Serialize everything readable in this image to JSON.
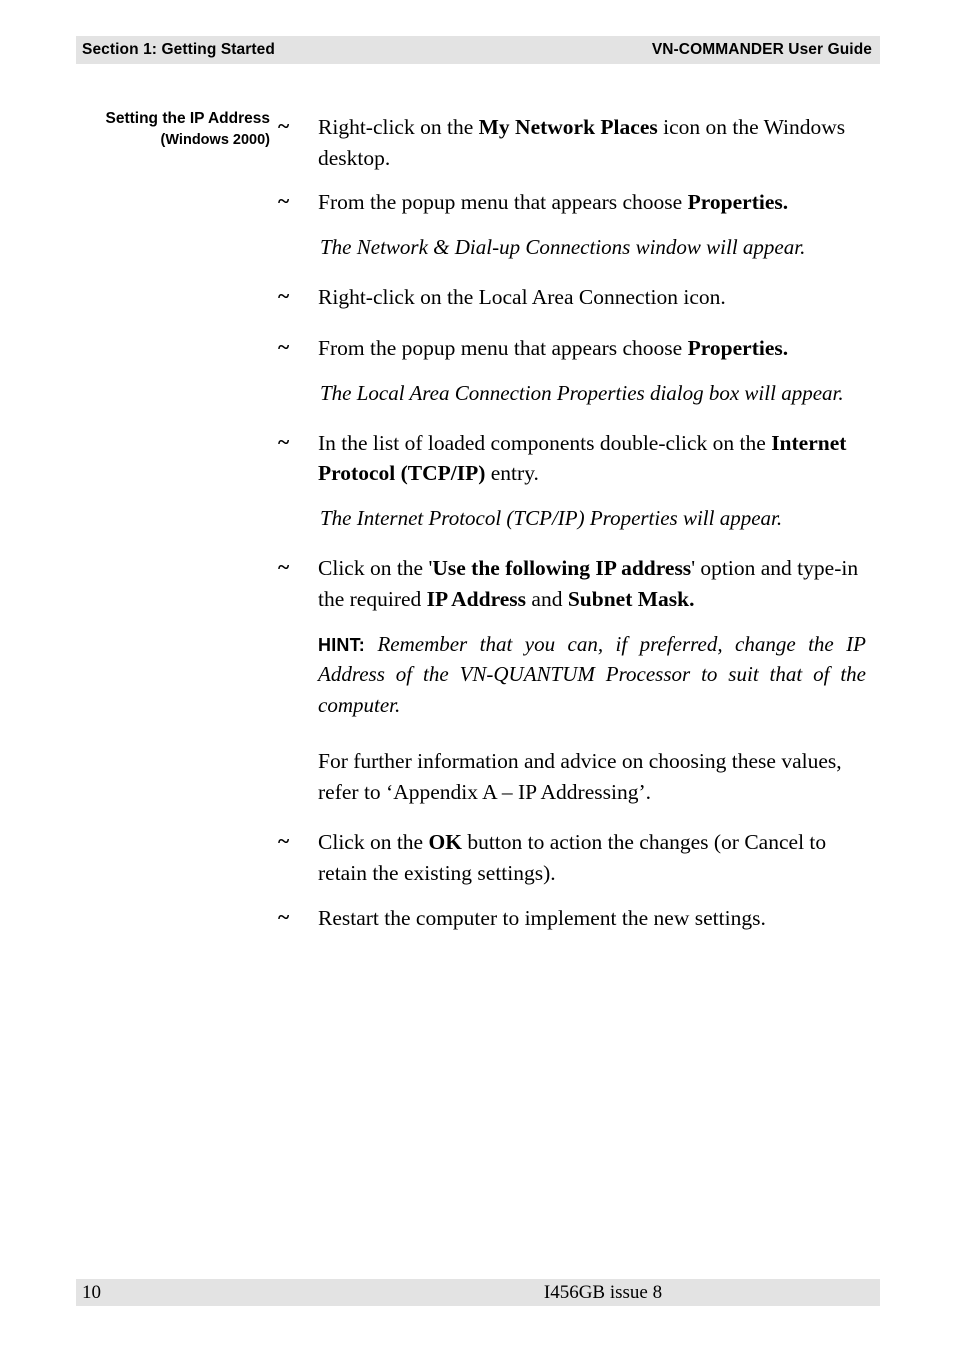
{
  "header": {
    "left": "Section 1: Getting Started",
    "right": "VN-COMMANDER User Guide"
  },
  "footer": {
    "page_number": "10",
    "document_ref": "I456GB issue 8"
  },
  "margin_heading": {
    "line1": "Setting the IP Address",
    "line2": "(Windows 2000)"
  },
  "bullet_glyph": "~",
  "steps": {
    "s1": {
      "pre": "Right-click on the ",
      "bold": "My Network Places",
      "post": " icon on the Windows desktop."
    },
    "s2": {
      "pre": "From the popup menu that appears choose ",
      "bold": "Properties."
    },
    "n1": "The Network & Dial-up Connections window will appear.",
    "s3": {
      "text": "Right-click on the Local Area Connection icon."
    },
    "s4": {
      "pre": "From the popup menu that appears choose ",
      "bold": "Properties."
    },
    "n2": "The Local Area Connection Properties dialog box will appear.",
    "s5": {
      "pre": "In the list of loaded components double-click on the ",
      "bold": "Internet Protocol (TCP/IP)",
      "post": " entry."
    },
    "n3": "The Internet Protocol (TCP/IP) Properties will appear.",
    "s6": {
      "pre": "Click on the '",
      "bold1": "Use the following IP address",
      "mid": "' option and type-in the required ",
      "bold2": "IP Address",
      "mid2": " and ",
      "bold3": "Subnet Mask."
    },
    "hint": {
      "label": "HINT:",
      "text": "Remember that you can, if preferred, change the IP Address of the VN-QUANTUM Processor to suit that of the computer."
    },
    "p1": "For further information and advice on choosing these values, refer to ‘Appendix A – IP Addressing’.",
    "s7": {
      "pre": "Click on the ",
      "bold": "OK",
      "post": " button to action the changes (or Cancel to retain the existing settings)."
    },
    "s8": {
      "text": "Restart the computer to implement the new settings."
    }
  }
}
